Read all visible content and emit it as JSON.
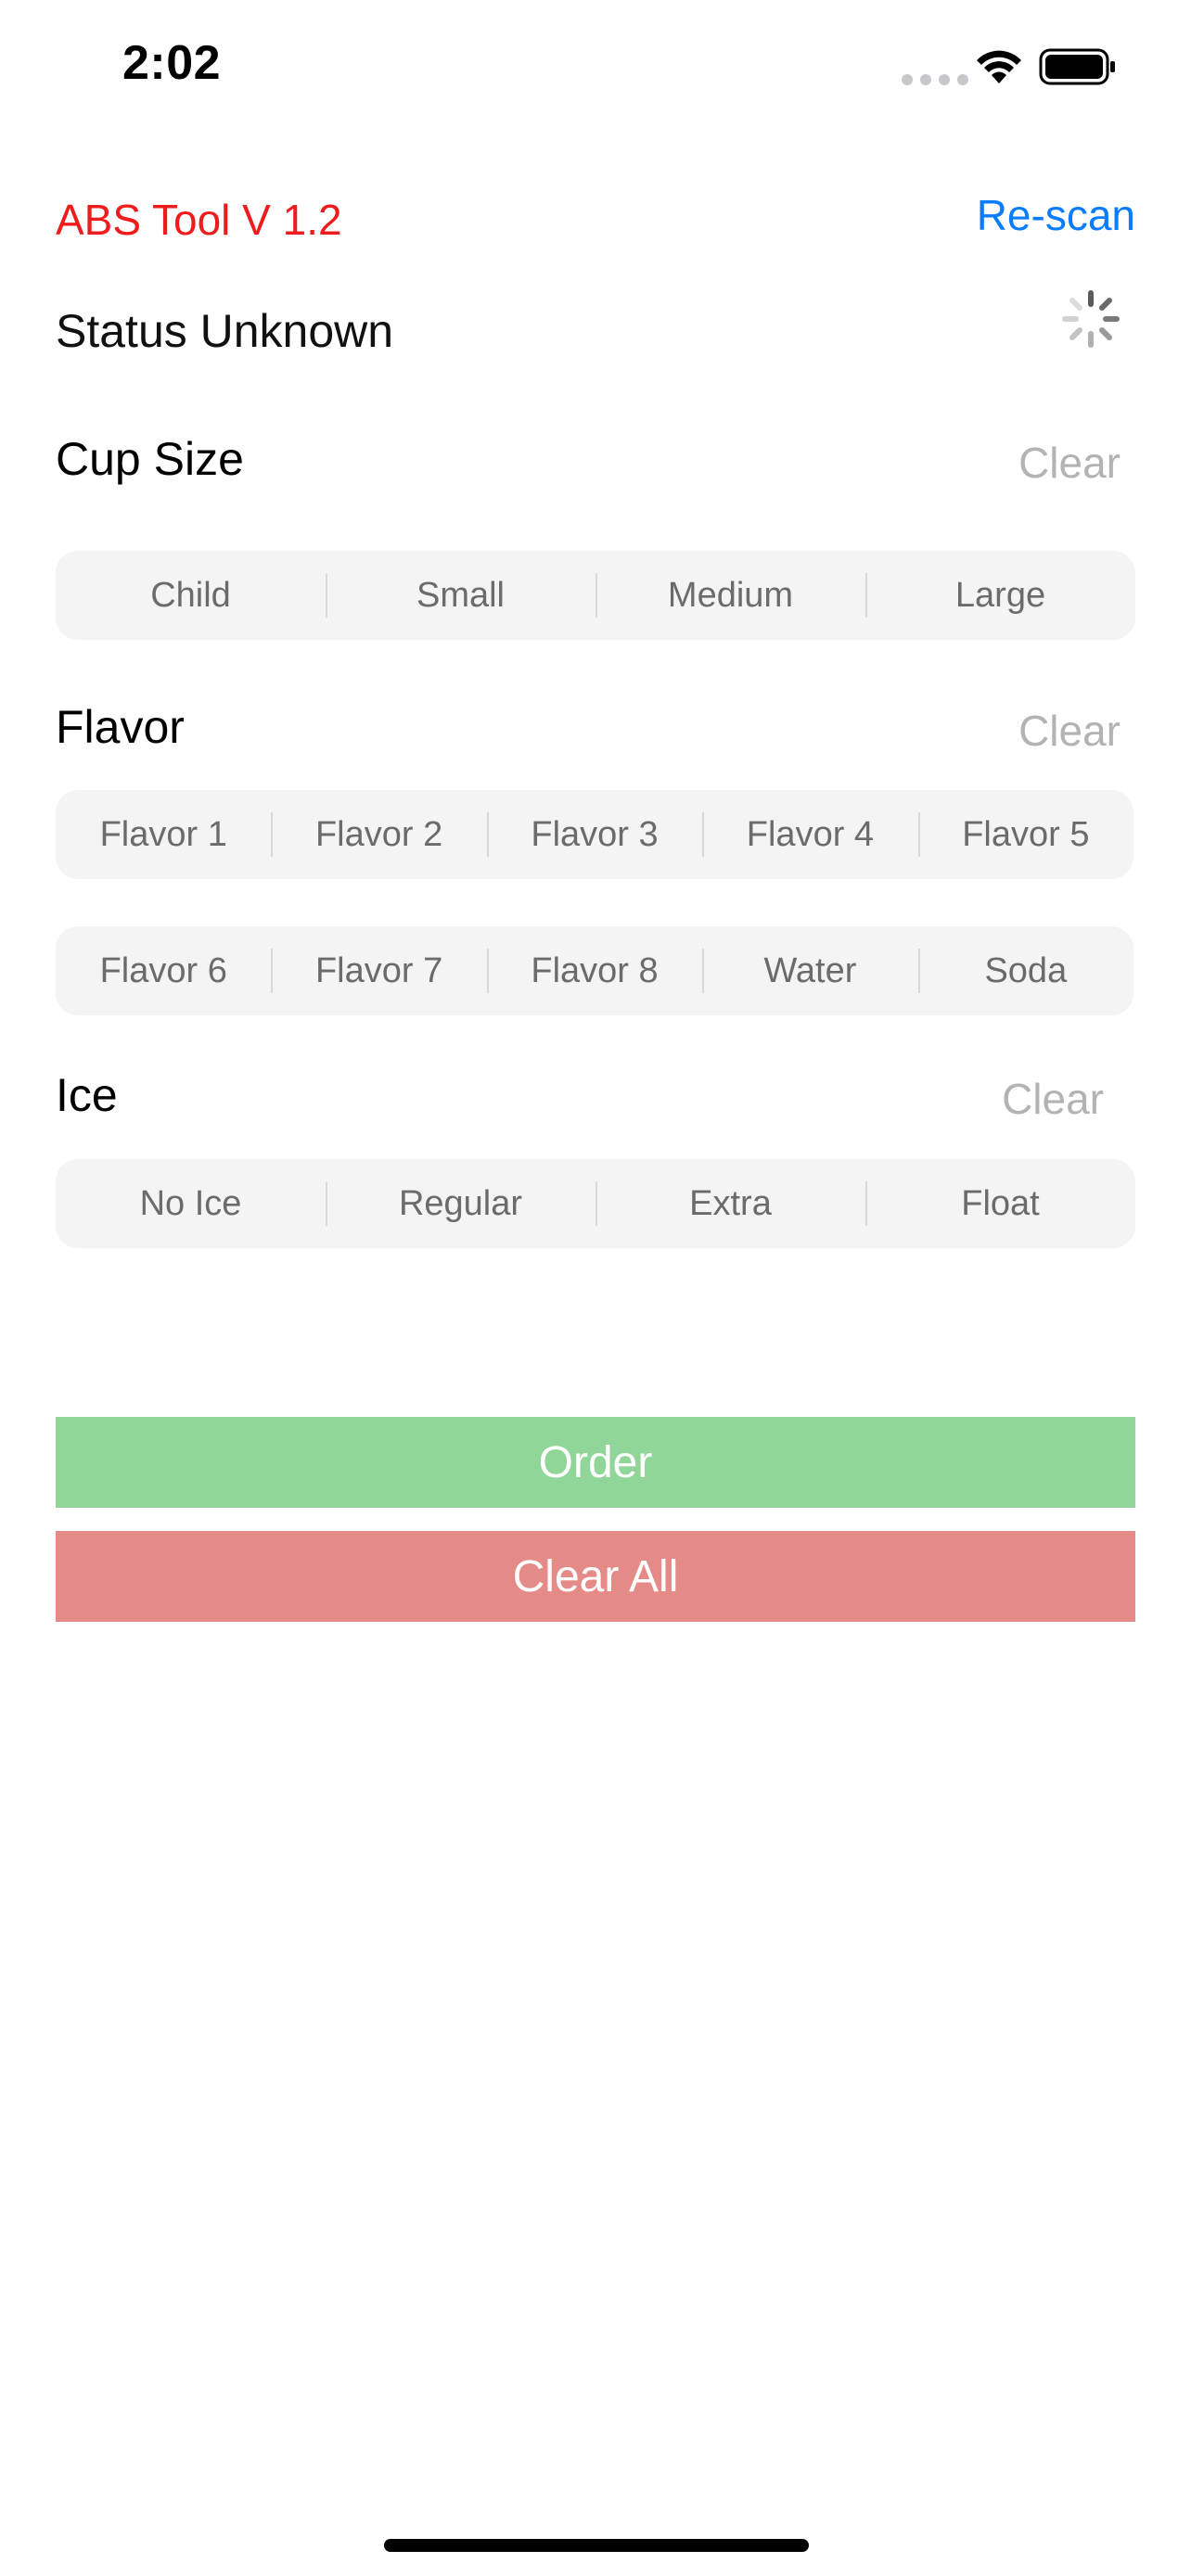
{
  "status_bar": {
    "time": "2:02"
  },
  "header": {
    "app_title": "ABS Tool V 1.2",
    "rescan_label": "Re-scan",
    "status_text": "Status Unknown"
  },
  "cup_size": {
    "title": "Cup Size",
    "clear_label": "Clear",
    "options": [
      "Child",
      "Small",
      "Medium",
      "Large"
    ]
  },
  "flavor": {
    "title": "Flavor",
    "clear_label": "Clear",
    "row1": [
      "Flavor 1",
      "Flavor 2",
      "Flavor 3",
      "Flavor 4",
      "Flavor 5"
    ],
    "row2": [
      "Flavor 6",
      "Flavor 7",
      "Flavor 8",
      "Water",
      "Soda"
    ]
  },
  "ice": {
    "title": "Ice",
    "clear_label": "Clear",
    "options": [
      "No Ice",
      "Regular",
      "Extra",
      "Float"
    ]
  },
  "actions": {
    "order_label": "Order",
    "clear_all_label": "Clear All"
  },
  "colors": {
    "title_red": "#ee1c1c",
    "link_blue": "#0a7cff",
    "order_green": "#8fd698",
    "clear_all_red": "#e48b88"
  },
  "icons": [
    "wifi-icon",
    "battery-icon",
    "spinner-icon"
  ]
}
